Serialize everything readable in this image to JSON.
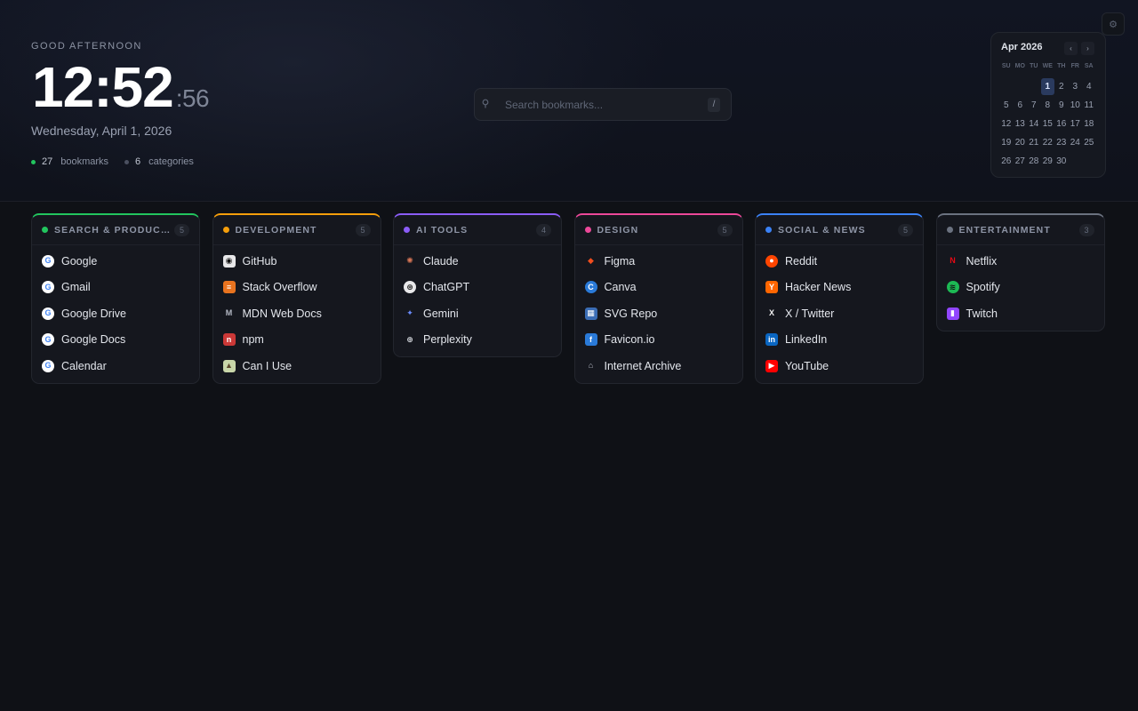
{
  "header": {
    "greeting": "GOOD AFTERNOON",
    "clock_hm": "12:52",
    "clock_sec": ":56",
    "date": "Wednesday, April 1, 2026",
    "stats": [
      {
        "count": "27",
        "label": "bookmarks",
        "dot_color": "#22c55e"
      },
      {
        "count": "6",
        "label": "categories",
        "dot_color": "#4b5060"
      }
    ]
  },
  "search": {
    "placeholder": "Search bookmarks...",
    "value": "",
    "shortcut": "/",
    "icon": "search-icon"
  },
  "settings": {
    "icon": "gear-icon"
  },
  "calendar": {
    "title": "Apr 2026",
    "prev": "‹",
    "next": "›",
    "weekdays": [
      "SU",
      "MO",
      "TU",
      "WE",
      "TH",
      "FR",
      "SA"
    ],
    "days": [
      "",
      "",
      "",
      "1",
      "2",
      "3",
      "4",
      "5",
      "6",
      "7",
      "8",
      "9",
      "10",
      "11",
      "12",
      "13",
      "14",
      "15",
      "16",
      "17",
      "18",
      "19",
      "20",
      "21",
      "22",
      "23",
      "24",
      "25",
      "26",
      "27",
      "28",
      "29",
      "30"
    ],
    "today": "1"
  },
  "categories": [
    {
      "title": "SEARCH & PRODUCT...",
      "count": "5",
      "color": "#22c55e",
      "items": [
        {
          "label": "Google",
          "icon": "google-icon"
        },
        {
          "label": "Gmail",
          "icon": "google-icon"
        },
        {
          "label": "Google Drive",
          "icon": "google-icon"
        },
        {
          "label": "Google Docs",
          "icon": "google-icon"
        },
        {
          "label": "Calendar",
          "icon": "google-icon"
        }
      ]
    },
    {
      "title": "DEVELOPMENT",
      "count": "5",
      "color": "#f59e0b",
      "items": [
        {
          "label": "GitHub",
          "icon": "github-icon"
        },
        {
          "label": "Stack Overflow",
          "icon": "stack-overflow-icon"
        },
        {
          "label": "MDN Web Docs",
          "icon": "mdn-icon"
        },
        {
          "label": "npm",
          "icon": "npm-icon"
        },
        {
          "label": "Can I Use",
          "icon": "caniuse-icon"
        }
      ]
    },
    {
      "title": "AI TOOLS",
      "count": "4",
      "color": "#8b5cf6",
      "items": [
        {
          "label": "Claude",
          "icon": "claude-icon"
        },
        {
          "label": "ChatGPT",
          "icon": "chatgpt-icon"
        },
        {
          "label": "Gemini",
          "icon": "gemini-icon"
        },
        {
          "label": "Perplexity",
          "icon": "perplexity-icon"
        }
      ]
    },
    {
      "title": "DESIGN",
      "count": "5",
      "color": "#ec4899",
      "items": [
        {
          "label": "Figma",
          "icon": "figma-icon"
        },
        {
          "label": "Canva",
          "icon": "canva-icon"
        },
        {
          "label": "SVG Repo",
          "icon": "svg-repo-icon"
        },
        {
          "label": "Favicon.io",
          "icon": "favicon-io-icon"
        },
        {
          "label": "Internet Archive",
          "icon": "internet-archive-icon"
        }
      ]
    },
    {
      "title": "SOCIAL & NEWS",
      "count": "5",
      "color": "#3b82f6",
      "items": [
        {
          "label": "Reddit",
          "icon": "reddit-icon"
        },
        {
          "label": "Hacker News",
          "icon": "hacker-news-icon"
        },
        {
          "label": "X / Twitter",
          "icon": "x-icon"
        },
        {
          "label": "LinkedIn",
          "icon": "linkedin-icon"
        },
        {
          "label": "YouTube",
          "icon": "youtube-icon"
        }
      ]
    },
    {
      "title": "ENTERTAINMENT",
      "count": "3",
      "color": "#6b7280",
      "items": [
        {
          "label": "Netflix",
          "icon": "netflix-icon"
        },
        {
          "label": "Spotify",
          "icon": "spotify-icon"
        },
        {
          "label": "Twitch",
          "icon": "twitch-icon"
        }
      ]
    }
  ]
}
